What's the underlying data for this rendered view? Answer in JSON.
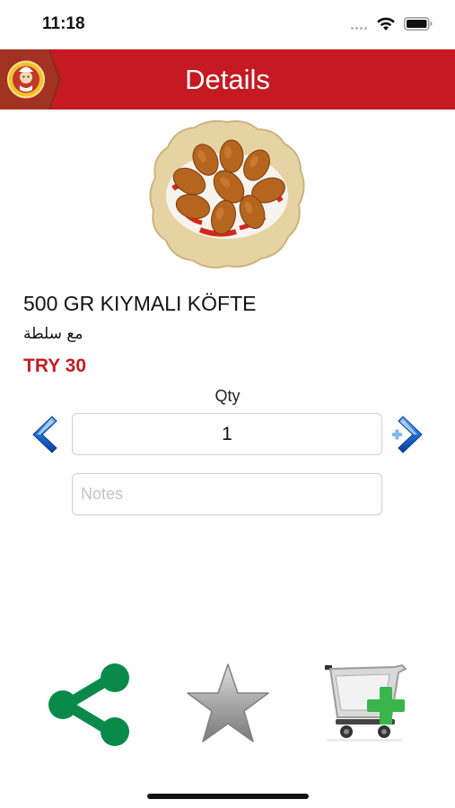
{
  "status_bar": {
    "time": "11:18",
    "icons": [
      "signal-dots-icon",
      "wifi-icon",
      "battery-icon"
    ]
  },
  "header": {
    "title": "Details",
    "logo": "restaurant-logo",
    "color": "#c51a22"
  },
  "product": {
    "image": "kofte-plate-image",
    "name": "500 GR KIYMALI KÖFTE",
    "description": "مع سلطة",
    "price": "TRY 30",
    "price_color": "#c51a22"
  },
  "quantity": {
    "label": "Qty",
    "value": "1",
    "decrement_icon": "chevron-left-icon",
    "increment_icon": "chevron-right-plus-icon"
  },
  "notes": {
    "placeholder": "Notes",
    "value": ""
  },
  "actions": [
    {
      "name": "share",
      "icon": "share-icon",
      "color": "#0a8a4a"
    },
    {
      "name": "favorite",
      "icon": "star-icon",
      "color": "#9a9a9a"
    },
    {
      "name": "add-to-cart",
      "icon": "cart-add-icon",
      "color": "#39b54a"
    }
  ]
}
